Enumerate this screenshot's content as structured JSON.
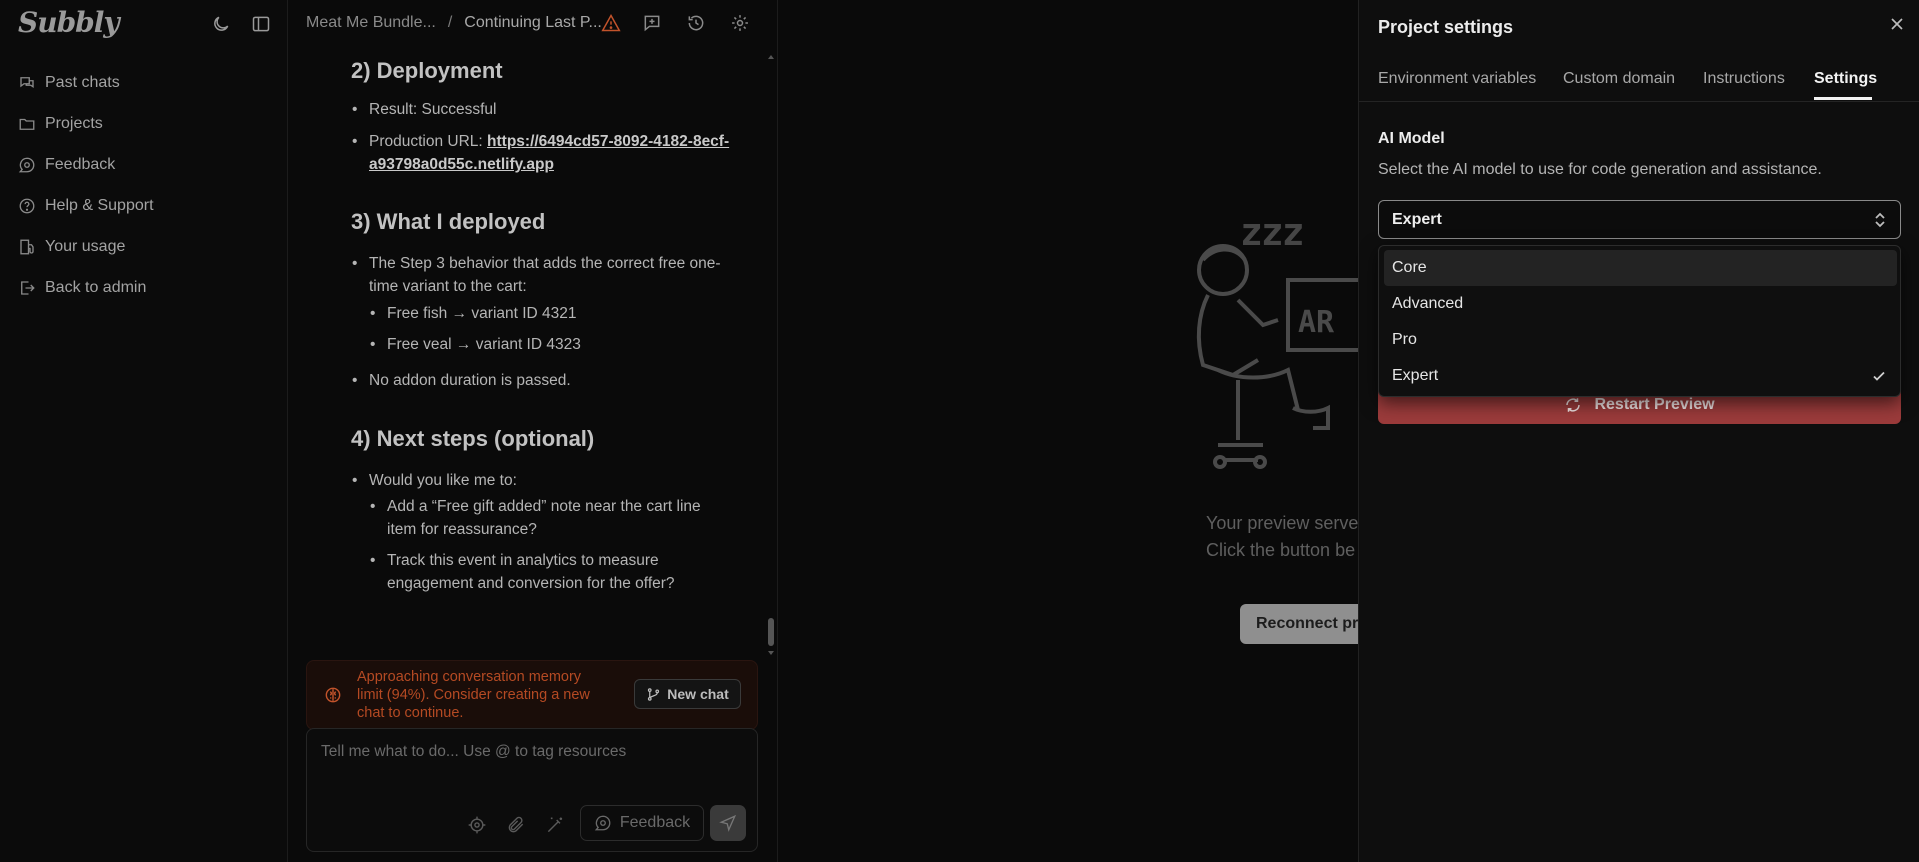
{
  "sidebar": {
    "logo": "Subbly",
    "items": [
      {
        "label": "Past chats",
        "icon": "chats-icon"
      },
      {
        "label": "Projects",
        "icon": "folder-icon"
      },
      {
        "label": "Feedback",
        "icon": "feedback-icon"
      },
      {
        "label": "Help & Support",
        "icon": "help-icon"
      },
      {
        "label": "Your usage",
        "icon": "usage-icon"
      },
      {
        "label": "Back to admin",
        "icon": "logout-icon"
      }
    ]
  },
  "chat": {
    "breadcrumb": {
      "project": "Meat Me Bundle...",
      "separator": "/",
      "chat": "Continuing Last P..."
    },
    "section2": {
      "title": "2) Deployment",
      "result": "Result: Successful",
      "url_label": "Production URL: ",
      "url_line1": "https://6494cd57-8092-4182-8ecf-",
      "url_line2": "a93798a0d55c.netlify.app"
    },
    "section3": {
      "title": "3) What I deployed",
      "item1_line1": "The Step 3 behavior that adds the correct free one-",
      "item1_line2": "time variant to the cart:",
      "sub1": "Free fish → variant ID 4321",
      "sub2": "Free veal → variant ID 4323",
      "item2": "No addon duration is passed."
    },
    "section4": {
      "title": "4) Next steps (optional)",
      "item1": "Would you like me to:",
      "sub1_line1": "Add a “Free gift added” note near the cart line",
      "sub1_line2": "item for reassurance?",
      "sub2_line1": "Track this event in analytics to measure",
      "sub2_line2": "engagement and conversion for the offer?"
    },
    "warning": {
      "line1": "Approaching conversation memory",
      "line2": "limit (94%). Consider creating a new",
      "line3": "chat to continue.",
      "button": "New chat"
    },
    "composer": {
      "placeholder": "Tell me what to do... Use @ to tag resources",
      "feedback_button": "Feedback"
    }
  },
  "preview": {
    "zzz": "zzz",
    "line1": "Your preview server",
    "line2": "Click the button be",
    "reconnect_button": "Reconnect pre"
  },
  "settings": {
    "title": "Project settings",
    "tabs": [
      "Environment variables",
      "Custom domain",
      "Instructions",
      "Settings"
    ],
    "active_tab": "Settings",
    "ai_model_title": "AI Model",
    "ai_model_desc": "Select the AI model to use for code generation and assistance.",
    "selected_model": "Expert",
    "options": [
      "Core",
      "Advanced",
      "Pro",
      "Expert"
    ],
    "restart_button": "Restart Preview"
  },
  "colors": {
    "warning_text": "#b54a23",
    "restart_bg": "#9b3b3b",
    "background": "#0a0a0a",
    "panel_bg": "#0e0e0e"
  }
}
